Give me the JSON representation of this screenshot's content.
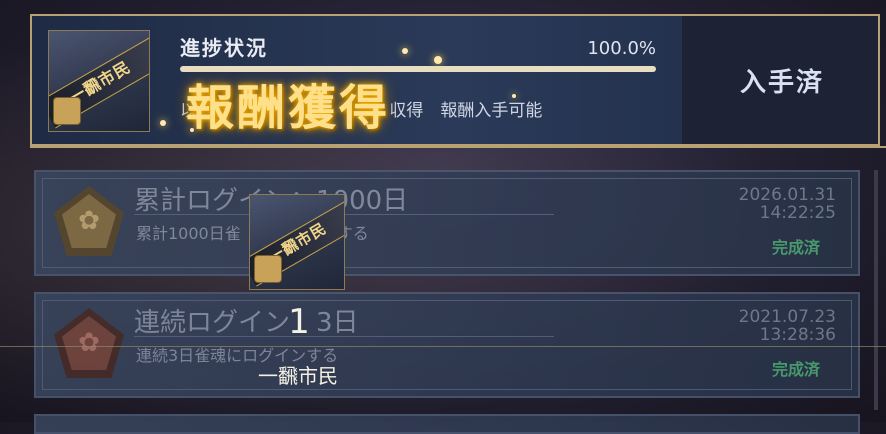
{
  "banner": {
    "progress_label": "進捗状況",
    "progress_value": "100.0%",
    "progress_fraction": 1.0,
    "description": "以　ヘ　　　 　　　　　　収得　報酬入手可能",
    "reward_title": "報酬獲得",
    "status_button": "入手済",
    "item_strip_text": "一飜市民"
  },
  "cards": [
    {
      "title": "累計ログイン：1000日",
      "description": "累計1000日雀　　　　　ンする",
      "date": "2026.01.31",
      "time": "14:22:25",
      "status": "完成済",
      "medal_color": "#8a7346"
    },
    {
      "title": "連続ログイン　3日",
      "description": "連続3日雀魂にログインする",
      "date": "2021.07.23",
      "time": "13:28:36",
      "status": "完成済",
      "medal_color": "#7a4a40"
    }
  ],
  "popup": {
    "count": "1",
    "item_name": "一飜市民",
    "item_strip_text": "一飜市民"
  }
}
